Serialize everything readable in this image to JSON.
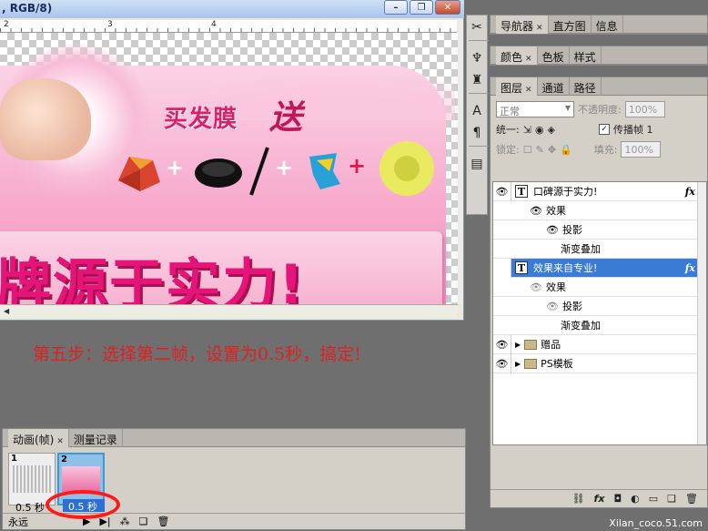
{
  "doc_window": {
    "title": ", RGB/8)",
    "ruler_marks": [
      "2",
      "3",
      "4"
    ],
    "minimize": "–",
    "restore": "❐",
    "close": "✕"
  },
  "banner": {
    "subtitle": "买发膜",
    "gift": "送",
    "main_text": "牌源于实力!"
  },
  "caption": "第五步：选择第二帧，设置为0.5秒，搞定!",
  "right_panels": {
    "navigator_tabs": [
      {
        "label": "导航器",
        "active": true
      },
      {
        "label": "直方图",
        "active": false
      },
      {
        "label": "信息",
        "active": false
      }
    ],
    "color_tabs": [
      {
        "label": "颜色",
        "active": true
      },
      {
        "label": "色板",
        "active": false
      },
      {
        "label": "样式",
        "active": false
      }
    ],
    "layers_tabs": [
      {
        "label": "图层",
        "active": true
      },
      {
        "label": "通道",
        "active": false
      },
      {
        "label": "路径",
        "active": false
      }
    ],
    "blend_mode": "正常",
    "opacity_label": "不透明度:",
    "opacity_value": "100%",
    "unify_label": "统一:",
    "propagate_label": "传播帧 1",
    "lock_label": "锁定:",
    "fill_label": "填充:",
    "fill_value": "100%"
  },
  "layers": [
    {
      "name": "口碑源于实力!",
      "type": "T",
      "fx": "fx",
      "visible": true,
      "selected": false
    },
    {
      "name": "效果",
      "indent": 1
    },
    {
      "name": "投影",
      "indent": 2
    },
    {
      "name": "渐变叠加",
      "indent": 2
    },
    {
      "name": "效果来自专业!",
      "type": "T",
      "fx": "fx",
      "visible": false,
      "selected": true
    },
    {
      "name": "效果",
      "indent": 1
    },
    {
      "name": "投影",
      "indent": 2
    },
    {
      "name": "渐变叠加",
      "indent": 2
    },
    {
      "name": "赠品",
      "type": "folder",
      "visible": true
    },
    {
      "name": "PS模板",
      "type": "folder",
      "visible": true
    }
  ],
  "animation": {
    "tabs": [
      {
        "label": "动画(帧)",
        "active": true
      },
      {
        "label": "测量记录",
        "active": false
      }
    ],
    "frames": [
      {
        "number": "1",
        "delay": "0.5 秒",
        "selected": false
      },
      {
        "number": "2",
        "delay": "0.5 秒",
        "selected": true
      }
    ],
    "loop": "永远"
  },
  "watermark": "Xilan_coco.51.com",
  "colors": {
    "selection": "#3a7bd5",
    "highlight_ring": "#ff1a1a",
    "caption": "#e02020",
    "banner_pink": "#e51479"
  }
}
